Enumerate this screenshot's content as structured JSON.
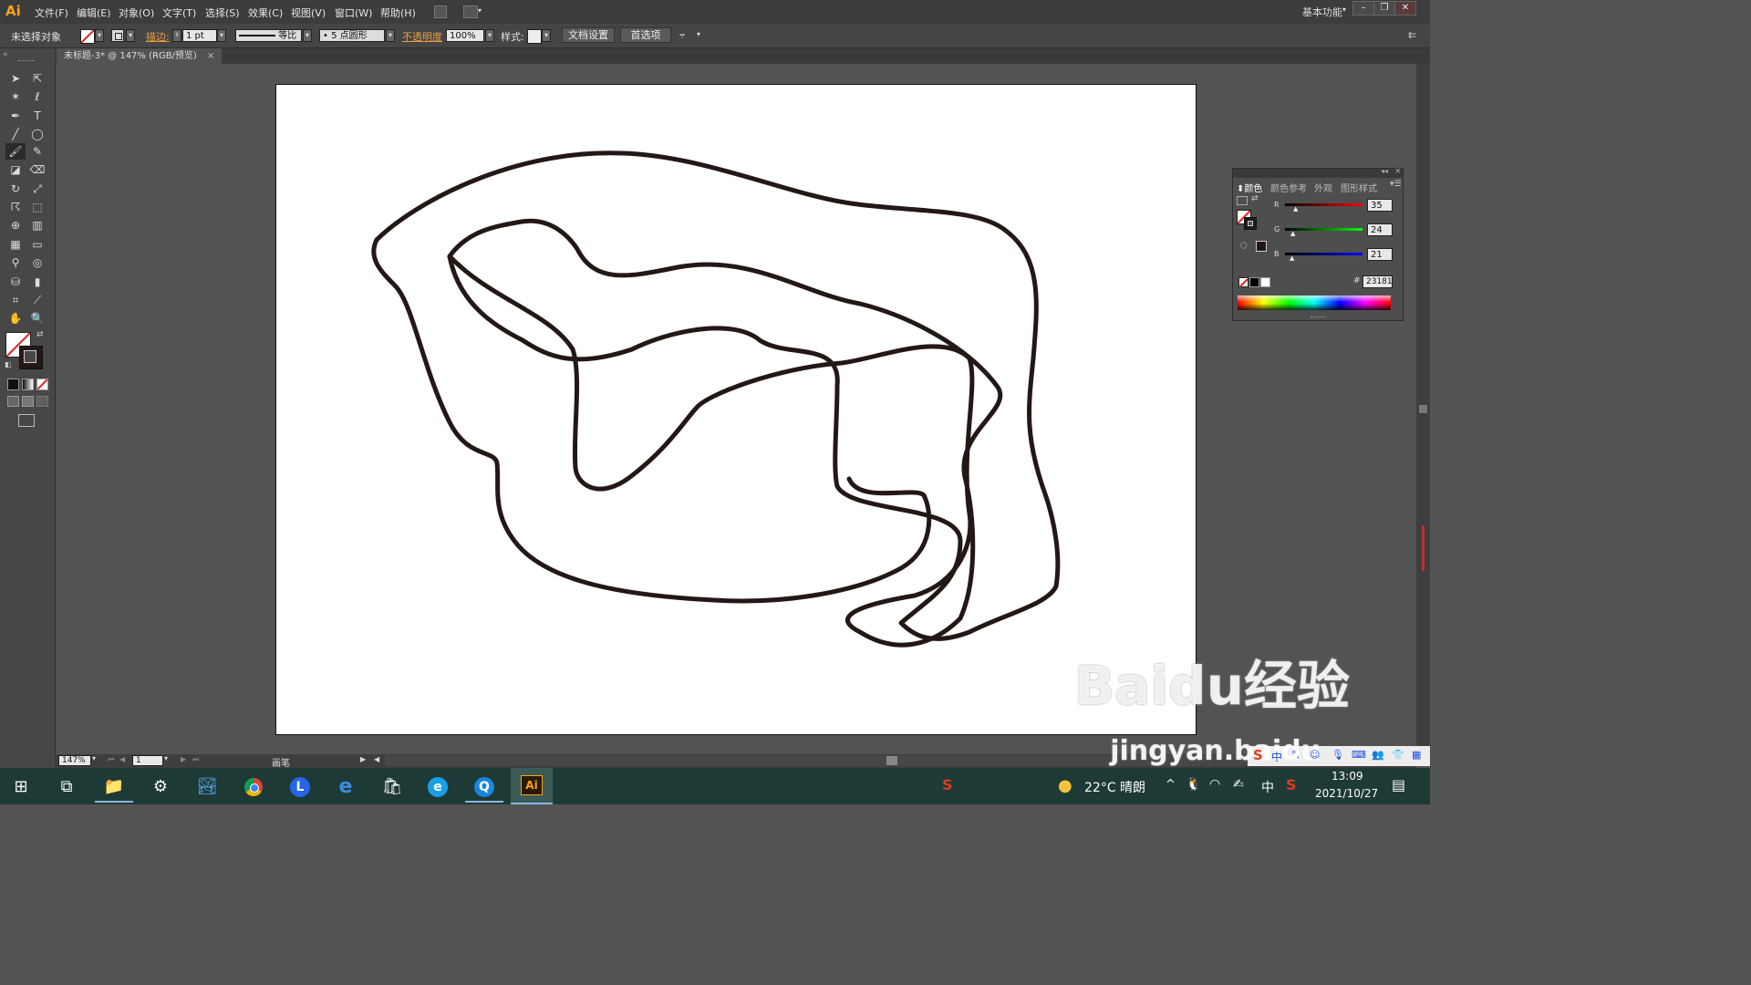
{
  "app": {
    "logo": "Ai"
  },
  "menu": [
    "文件(F)",
    "编辑(E)",
    "对象(O)",
    "文字(T)",
    "选择(S)",
    "效果(C)",
    "视图(V)",
    "窗口(W)",
    "帮助(H)"
  ],
  "workspace": "基本功能",
  "control": {
    "selection": "未选择对象",
    "stroke_label": "描边:",
    "stroke_weight": "1 pt",
    "line_profile": "等比",
    "brush": "5 点圆形",
    "opacity_label": "不透明度",
    "opacity": "100%",
    "style_label": "样式:",
    "doc_setup": "文档设置",
    "prefs": "首选项"
  },
  "document": {
    "tab_title": "未标题-3* @ 147% (RGB/预览)",
    "close": "×"
  },
  "status": {
    "zoom": "147%",
    "page": "1",
    "tool": "画笔"
  },
  "color_panel": {
    "tabs": [
      "颜色",
      "颜色参考",
      "外观",
      "图形样式"
    ],
    "r_label": "R",
    "g_label": "G",
    "b_label": "B",
    "r": "35",
    "g": "24",
    "b": "21",
    "hash": "#",
    "hex": "231815",
    "stroke_color": "#231815"
  },
  "taskbar": {
    "weather": "22°C 晴朗",
    "ime": "中",
    "time": "13:09",
    "date": "2021/10/27"
  },
  "watermark": {
    "brand": "Baidu经验",
    "url": "jingyan.baidu"
  }
}
